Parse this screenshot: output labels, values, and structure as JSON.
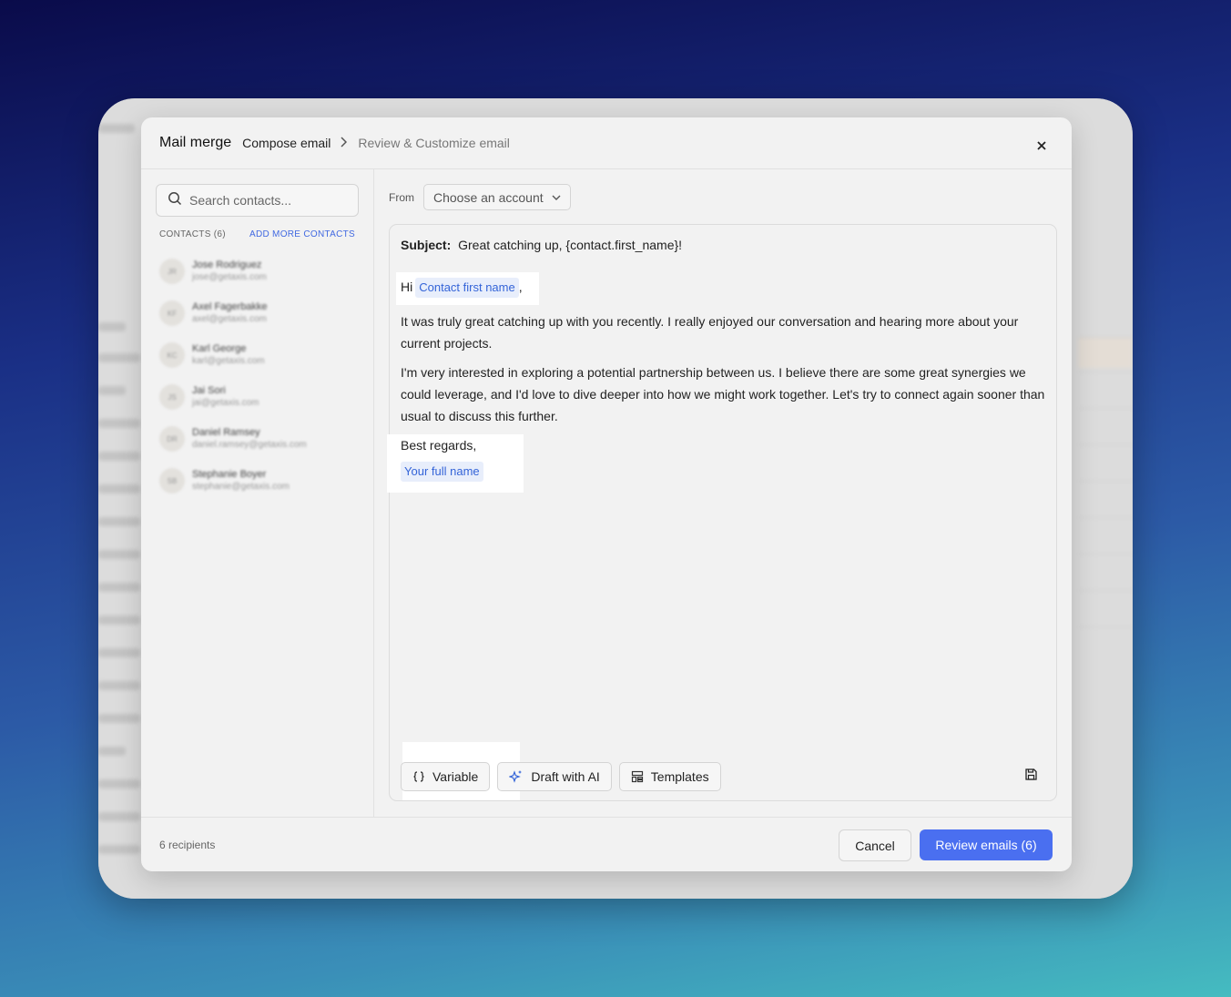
{
  "modal": {
    "title": "Mail merge",
    "breadcrumb": [
      "Compose email",
      "Review & Customize email"
    ]
  },
  "sidebar": {
    "search_placeholder": "Search contacts...",
    "contacts_count": "CONTACTS (6)",
    "add_more": "ADD MORE CONTACTS",
    "contacts": [
      {
        "initials": "JR",
        "name": "Jose Rodriguez",
        "email": "jose@getaxis.com"
      },
      {
        "initials": "KF",
        "name": "Axel Fagerbakke",
        "email": "axel@getaxis.com"
      },
      {
        "initials": "KC",
        "name": "Karl George",
        "email": "karl@getaxis.com"
      },
      {
        "initials": "JS",
        "name": "Jai Sori",
        "email": "jai@getaxis.com"
      },
      {
        "initials": "DR",
        "name": "Daniel Ramsey",
        "email": "daniel.ramsey@getaxis.com"
      },
      {
        "initials": "SB",
        "name": "Stephanie Boyer",
        "email": "stephanie@getaxis.com"
      }
    ]
  },
  "compose": {
    "from_label": "From",
    "account_placeholder": "Choose an account",
    "subject_label": "Subject:",
    "subject_value": "Great catching up, {contact.first_name}!",
    "greeting": "Hi",
    "greeting_variable": "Contact first name",
    "greeting_suffix": ",",
    "paragraph1": "It was truly great catching up with you recently. I really enjoyed our conversation and hearing more about your current projects.",
    "paragraph2": "I'm very interested in exploring a potential partnership between us. I believe there are some great synergies we could leverage, and I'd love to dive deeper into how we might work together. Let's try to connect again sooner than usual to discuss this further.",
    "closing": "Best regards,",
    "signature_variable": "Your full name",
    "toolbar": {
      "variable": "Variable",
      "draft_ai": "Draft with AI",
      "templates": "Templates"
    }
  },
  "footer": {
    "recipients": "6 recipients",
    "cancel": "Cancel",
    "review": "Review emails (6)"
  },
  "colors": {
    "accent": "#4a6ff0",
    "link": "#4169e1",
    "chip_bg": "#e8eefb"
  }
}
